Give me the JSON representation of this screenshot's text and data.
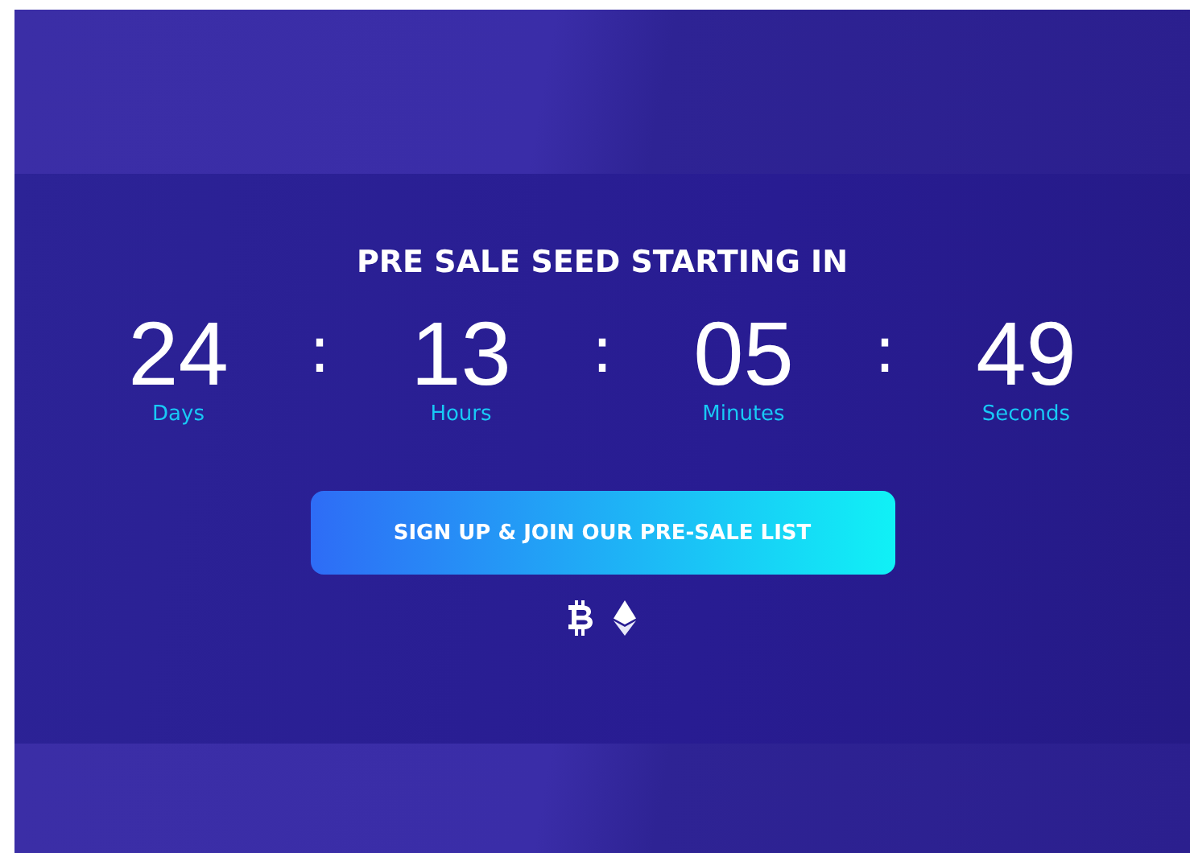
{
  "heading": "PRE SALE SEED STARTING IN",
  "countdown": [
    {
      "value": "24",
      "unit": "Days"
    },
    {
      "value": "13",
      "unit": "Hours"
    },
    {
      "value": "05",
      "unit": "Minutes"
    },
    {
      "value": "49",
      "unit": "Seconds"
    }
  ],
  "separator": ":",
  "button": "SIGN UP & JOIN OUR PRE-SALE LIST"
}
